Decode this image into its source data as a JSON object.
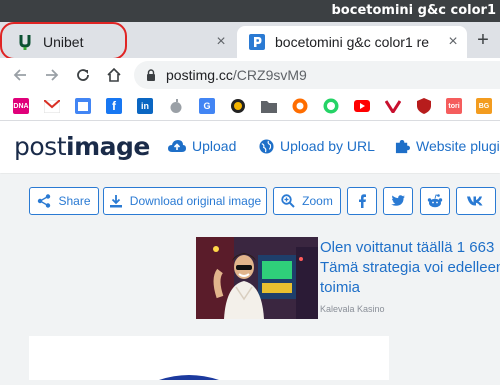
{
  "window": {
    "title": "bocetomini g&c color1"
  },
  "tabs": [
    {
      "title": "Unibet",
      "favicon": "unibet-icon",
      "highlighted": true,
      "active": false,
      "close": "×"
    },
    {
      "title": "bocetomini g&c color1 re",
      "favicon": "postimage-icon",
      "active": true,
      "close": "×"
    }
  ],
  "new_tab_label": "+",
  "address_bar": {
    "host": "postimg.cc",
    "path": "/CRZ9svM9"
  },
  "bookmarks": [
    "dna-icon",
    "gmail-icon",
    "calendar-icon",
    "facebook-icon",
    "linkedin-icon",
    "apple-icon",
    "translate-icon",
    "podcast-icon",
    "folder-icon",
    "orange-circle-icon",
    "whatsapp-icon",
    "youtube-icon",
    "vivaldi-icon",
    "shield-icon",
    "tori-icon",
    "bg-icon"
  ],
  "bookmark_text": {
    "dna": "DNA",
    "tori": "tori",
    "bg": "BG"
  },
  "site": {
    "logo_light": "post",
    "logo_bold": "image",
    "nav": [
      {
        "label": "Upload",
        "icon": "cloud-upload-icon"
      },
      {
        "label": "Upload by URL",
        "icon": "globe-icon"
      },
      {
        "label": "Website plugin",
        "icon": "puzzle-icon"
      }
    ]
  },
  "share_bar": {
    "share_label": "Share",
    "download_label": "Download original image",
    "zoom_label": "Zoom",
    "social": [
      "facebook-icon",
      "twitter-icon",
      "reddit-icon",
      "vk-icon"
    ]
  },
  "ad": {
    "headline_line1": "Olen voittanut täällä 1 663",
    "headline_line2": "Tämä strategia voi edelleen",
    "headline_line3": "toimia",
    "source": "Kalevala Kasino"
  },
  "colors": {
    "accent": "#1e6fc8",
    "highlight": "#e02424",
    "logo": "#1a2b49"
  }
}
